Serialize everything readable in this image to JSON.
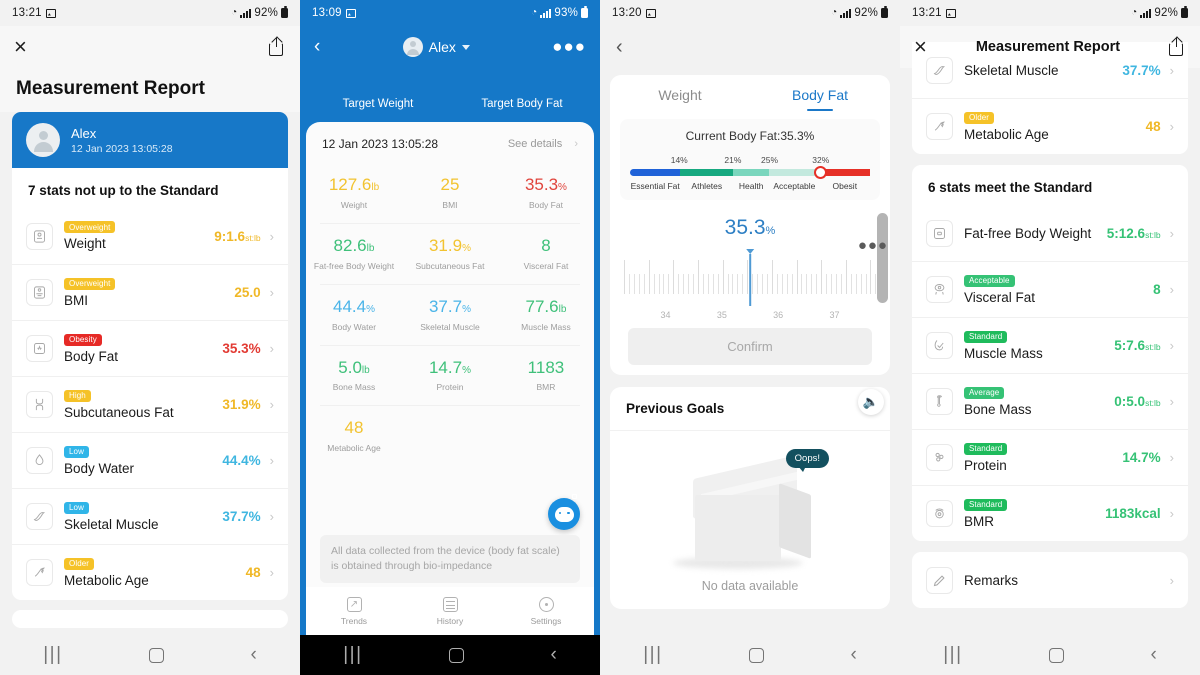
{
  "panel1": {
    "status": {
      "time": "13:21",
      "battery": "92%"
    },
    "topbar": {
      "close": "×"
    },
    "title": "Measurement Report",
    "user": {
      "name": "Alex",
      "datetime": "12 Jan 2023 13:05:28"
    },
    "section_header": "7 stats not up to the Standard",
    "rows": [
      {
        "badge": "Overweight",
        "badge_color": "#f5c228",
        "label": "Weight",
        "value": "9:1.6",
        "unit": "st:lb",
        "value_color": "#f0b827"
      },
      {
        "badge": "Overweight",
        "badge_color": "#f5c228",
        "label": "BMI",
        "value": "25.0",
        "unit": "",
        "value_color": "#f0b827"
      },
      {
        "badge": "Obesity",
        "badge_color": "#e62a26",
        "label": "Body Fat",
        "value": "35.3%",
        "unit": "",
        "value_color": "#e23a33"
      },
      {
        "badge": "High",
        "badge_color": "#f5c228",
        "label": "Subcutaneous Fat",
        "value": "31.9%",
        "unit": "",
        "value_color": "#f0b827"
      },
      {
        "badge": "Low",
        "badge_color": "#30b5e8",
        "label": "Body Water",
        "value": "44.4%",
        "unit": "",
        "value_color": "#3fb6e0"
      },
      {
        "badge": "Low",
        "badge_color": "#30b5e8",
        "label": "Skeletal Muscle",
        "value": "37.7%",
        "unit": "",
        "value_color": "#3fb6e0"
      },
      {
        "badge": "Older",
        "badge_color": "#f5c228",
        "label": "Metabolic Age",
        "value": "48",
        "unit": "",
        "value_color": "#f0b827"
      }
    ]
  },
  "panel2": {
    "status": {
      "time": "13:09",
      "battery": "93%"
    },
    "user_name": "Alex",
    "more": "●●●",
    "targets": [
      "Target Weight",
      "Target Body Fat"
    ],
    "sheet": {
      "date": "12 Jan 2023 13:05:28",
      "see_details": "See details"
    },
    "metrics": [
      {
        "value": "127.6",
        "unit": "lb",
        "name": "Weight",
        "color": "#f2c330"
      },
      {
        "value": "25",
        "unit": "",
        "name": "BMI",
        "color": "#f2c330"
      },
      {
        "value": "35.3",
        "unit": "%",
        "name": "Body Fat",
        "color": "#e0443c"
      },
      {
        "value": "82.6",
        "unit": "lb",
        "name": "Fat-free Body Weight",
        "color": "#3fc07a"
      },
      {
        "value": "31.9",
        "unit": "%",
        "name": "Subcutaneous Fat",
        "color": "#f2c330"
      },
      {
        "value": "8",
        "unit": "",
        "name": "Visceral Fat",
        "color": "#3fc07a"
      },
      {
        "value": "44.4",
        "unit": "%",
        "name": "Body Water",
        "color": "#4ab4e8"
      },
      {
        "value": "37.7",
        "unit": "%",
        "name": "Skeletal Muscle",
        "color": "#4ab4e8"
      },
      {
        "value": "77.6",
        "unit": "lb",
        "name": "Muscle Mass",
        "color": "#3fc07a"
      },
      {
        "value": "5.0",
        "unit": "lb",
        "name": "Bone Mass",
        "color": "#3fc07a"
      },
      {
        "value": "14.7",
        "unit": "%",
        "name": "Protein",
        "color": "#3fc07a"
      },
      {
        "value": "1183",
        "unit": "",
        "name": "BMR",
        "color": "#3fc07a"
      },
      {
        "value": "48",
        "unit": "",
        "name": "Metabolic Age",
        "color": "#f2c330"
      }
    ],
    "disclaimer": "All data collected from the device (body fat scale) is obtained through bio-impedance",
    "tabs": [
      {
        "label": "Trends",
        "icon": "trends-icon"
      },
      {
        "label": "History",
        "icon": "history-icon"
      },
      {
        "label": "Settings",
        "icon": "settings-icon"
      }
    ]
  },
  "panel3": {
    "status": {
      "time": "13:20",
      "battery": "92%"
    },
    "tabs": [
      {
        "label": "Weight",
        "active": false
      },
      {
        "label": "Body Fat",
        "active": true
      }
    ],
    "current_label": "Current Body Fat:35.3%",
    "scale": {
      "tick_labels": [
        "14%",
        "21%",
        "25%",
        "32%"
      ],
      "zones": [
        {
          "label": "Essential Fat",
          "color": "#1f62d8"
        },
        {
          "label": "Athletes",
          "color": "#17a980"
        },
        {
          "label": "Health",
          "color": "#7ad6bd"
        },
        {
          "label": "Acceptable",
          "color": "#c3e9de"
        },
        {
          "label": "Obesit",
          "color": "#e63027"
        }
      ],
      "knob_percent": 79
    },
    "picker": {
      "value": "35.3",
      "unit": "%",
      "ruler_numbers": [
        "34",
        "35",
        "36",
        "37"
      ]
    },
    "confirm_label": "Confirm",
    "goals": {
      "title": "Previous Goals",
      "bubble": "Oops!",
      "empty": "No data available"
    }
  },
  "panel4": {
    "status": {
      "time": "13:21",
      "battery": "92%"
    },
    "title": "Measurement Report",
    "partial_rows": [
      {
        "badge": "",
        "badge_color": "",
        "label": "Skeletal Muscle",
        "value": "37.7%",
        "unit": "",
        "value_color": "#3fb6e0"
      },
      {
        "badge": "Older",
        "badge_color": "#f5c228",
        "label": "Metabolic Age",
        "value": "48",
        "unit": "",
        "value_color": "#f0b827"
      }
    ],
    "section_header": "6 stats meet the Standard",
    "rows": [
      {
        "badge": "",
        "badge_color": "",
        "label": "Fat-free Body Weight",
        "value": "5:12.6",
        "unit": "st:lb",
        "value_color": "#35c275"
      },
      {
        "badge": "Acceptable",
        "badge_color": "#35c275",
        "label": "Visceral Fat",
        "value": "8",
        "unit": "",
        "value_color": "#35c275"
      },
      {
        "badge": "Standard",
        "badge_color": "#1fbb5c",
        "label": "Muscle Mass",
        "value": "5:7.6",
        "unit": "st:lb",
        "value_color": "#35c275"
      },
      {
        "badge": "Average",
        "badge_color": "#35c275",
        "label": "Bone Mass",
        "value": "0:5.0",
        "unit": "st:lb",
        "value_color": "#35c275"
      },
      {
        "badge": "Standard",
        "badge_color": "#1fbb5c",
        "label": "Protein",
        "value": "14.7%",
        "unit": "",
        "value_color": "#35c275"
      },
      {
        "badge": "Standard",
        "badge_color": "#1fbb5c",
        "label": "BMR",
        "value": "1183kcal",
        "unit": "",
        "value_color": "#35c275"
      }
    ],
    "remarks": "Remarks"
  },
  "navbar": {
    "recents": "|||",
    "home": "",
    "back": "‹"
  }
}
